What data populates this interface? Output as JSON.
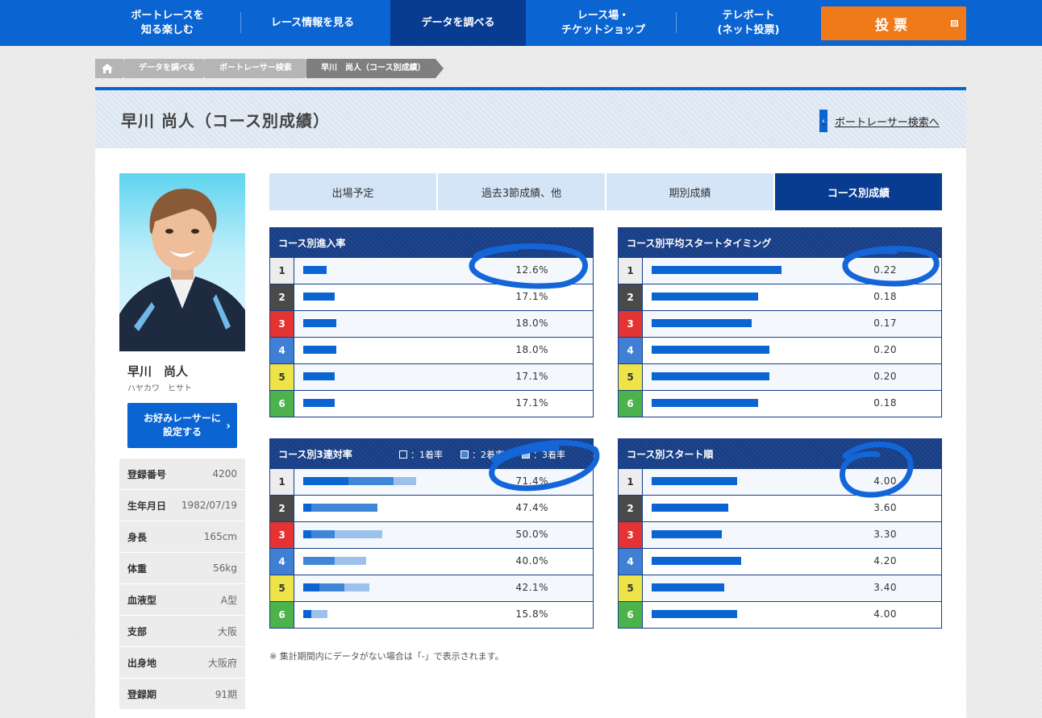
{
  "nav": {
    "items": [
      {
        "label": "ボートレースを\n知る楽しむ"
      },
      {
        "label": "レース情報を見る"
      },
      {
        "label": "データを調べる"
      },
      {
        "label": "レース場・\nチケットショップ"
      },
      {
        "label": "テレボート\n(ネット投票)"
      }
    ],
    "vote_label": "投票"
  },
  "breadcrumb": [
    "データを調べる",
    "ボートレーサー検索",
    "早川　尚人（コース別成績）"
  ],
  "page": {
    "title": "早川 尚人（コース別成績）",
    "back_link": "ボートレーサー検索へ"
  },
  "racer": {
    "name": "早川　尚人",
    "kana": "ハヤカワ　ヒサト",
    "fav_button": "お好みレーサーに\n設定する",
    "profile": [
      {
        "label": "登録番号",
        "value": "4200"
      },
      {
        "label": "生年月日",
        "value": "1982/07/19"
      },
      {
        "label": "身長",
        "value": "165cm"
      },
      {
        "label": "体重",
        "value": "56kg"
      },
      {
        "label": "血液型",
        "value": "A型"
      },
      {
        "label": "支部",
        "value": "大阪"
      },
      {
        "label": "出身地",
        "value": "大阪府"
      },
      {
        "label": "登録期",
        "value": "91期"
      }
    ]
  },
  "tabs": [
    "出場予定",
    "過去3節成績、他",
    "期別成績",
    "コース別成績"
  ],
  "course_colors": [
    "#ededed",
    "#4a4a4a",
    "#e53333",
    "#3f7fd4",
    "#efe34a",
    "#4cb24c"
  ],
  "course_text_colors": [
    "#333333",
    "#ffffff",
    "#ffffff",
    "#ffffff",
    "#333333",
    "#ffffff"
  ],
  "tables": {
    "entry": {
      "title": "コース別進入率",
      "rows": [
        {
          "course": "1",
          "value": "12.6%",
          "bars": [
            12.6
          ]
        },
        {
          "course": "2",
          "value": "17.1%",
          "bars": [
            17.1
          ]
        },
        {
          "course": "3",
          "value": "18.0%",
          "bars": [
            18.0
          ]
        },
        {
          "course": "4",
          "value": "18.0%",
          "bars": [
            18.0
          ]
        },
        {
          "course": "5",
          "value": "17.1%",
          "bars": [
            17.1
          ]
        },
        {
          "course": "6",
          "value": "17.1%",
          "bars": [
            17.1
          ]
        }
      ]
    },
    "start_timing": {
      "title": "コース別平均スタートタイミング",
      "rows": [
        {
          "course": "1",
          "value": "0.22",
          "bars": [
            0.22
          ]
        },
        {
          "course": "2",
          "value": "0.18",
          "bars": [
            0.18
          ]
        },
        {
          "course": "3",
          "value": "0.17",
          "bars": [
            0.17
          ]
        },
        {
          "course": "4",
          "value": "0.20",
          "bars": [
            0.2
          ]
        },
        {
          "course": "5",
          "value": "0.20",
          "bars": [
            0.2
          ]
        },
        {
          "course": "6",
          "value": "0.18",
          "bars": [
            0.18
          ]
        }
      ]
    },
    "trio": {
      "title": "コース別3連対率",
      "legend": [
        "：1着率",
        "：2着率",
        "：3着率"
      ],
      "segment_colors": [
        "#0a64d2",
        "#3f86d8",
        "#9cc2ec"
      ],
      "rows": [
        {
          "course": "1",
          "value": "71.4%",
          "bars": [
            28.6,
            28.6,
            14.2
          ]
        },
        {
          "course": "2",
          "value": "47.4%",
          "bars": [
            5.3,
            42.1,
            0
          ]
        },
        {
          "course": "3",
          "value": "50.0%",
          "bars": [
            5.0,
            15.0,
            30.0
          ]
        },
        {
          "course": "4",
          "value": "40.0%",
          "bars": [
            0,
            20.0,
            20.0
          ]
        },
        {
          "course": "5",
          "value": "42.1%",
          "bars": [
            10.5,
            15.8,
            15.8
          ]
        },
        {
          "course": "6",
          "value": "15.8%",
          "bars": [
            5.3,
            0,
            10.5
          ]
        }
      ]
    },
    "start_order": {
      "title": "コース別スタート順",
      "rows": [
        {
          "course": "1",
          "value": "4.00",
          "bars": [
            4.0
          ]
        },
        {
          "course": "2",
          "value": "3.60",
          "bars": [
            3.6
          ]
        },
        {
          "course": "3",
          "value": "3.30",
          "bars": [
            3.3
          ]
        },
        {
          "course": "4",
          "value": "4.20",
          "bars": [
            4.2
          ]
        },
        {
          "course": "5",
          "value": "3.40",
          "bars": [
            3.4
          ]
        },
        {
          "course": "6",
          "value": "4.00",
          "bars": [
            4.0
          ]
        }
      ]
    }
  },
  "note": "※ 集計期間内にデータがない場合は「-」で表示されます。",
  "annotation_color": "#1466d8"
}
